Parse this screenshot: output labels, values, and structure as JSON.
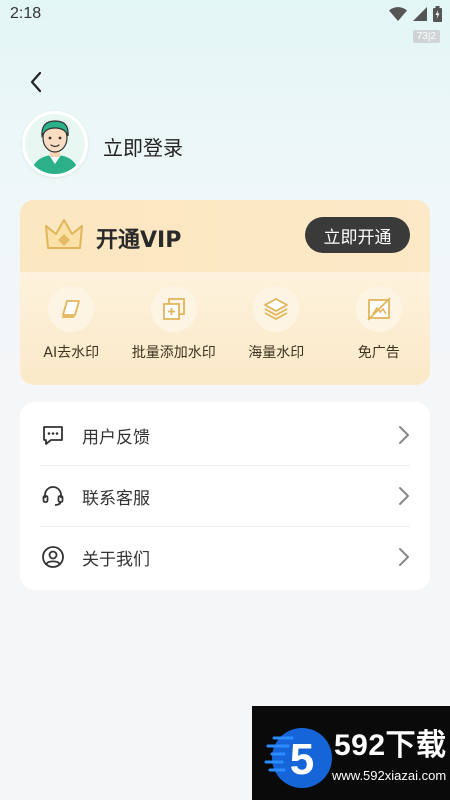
{
  "status_bar": {
    "time": "2:18",
    "hud_badge": "73|2"
  },
  "profile": {
    "login_label": "立即登录"
  },
  "vip": {
    "title": "开通VIP",
    "open_button": "立即开通",
    "features": [
      {
        "label": "AI去水印",
        "icon": "eraser-icon"
      },
      {
        "label": "批量添加水印",
        "icon": "batch-add-icon"
      },
      {
        "label": "海量水印",
        "icon": "layers-icon"
      },
      {
        "label": "免广告",
        "icon": "no-ads-icon"
      }
    ]
  },
  "menu": {
    "items": [
      {
        "label": "用户反馈",
        "icon": "feedback-icon"
      },
      {
        "label": "联系客服",
        "icon": "headset-icon"
      },
      {
        "label": "关于我们",
        "icon": "user-circle-icon"
      }
    ]
  },
  "watermark": {
    "title": "592下载",
    "url": "www.592xiazai.com",
    "logo_digit": "5"
  },
  "colors": {
    "vip_gold": "#fbe6bd",
    "dark_button": "#3a3a3a",
    "avatar_green": "#2bb08a"
  }
}
